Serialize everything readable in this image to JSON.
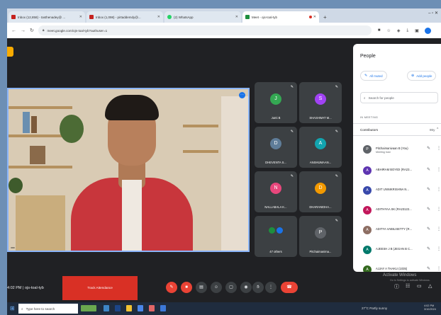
{
  "browser": {
    "tabs": [
      {
        "title": "Inbox (12,858) - tasthenadey@ ..."
      },
      {
        "title": "Inbox (1,098) - pirtaddemdy@..."
      },
      {
        "title": "(2) WhatsApp"
      },
      {
        "title": "Meet - ojs-toal-tyb"
      }
    ],
    "new_tab": "+",
    "window_controls": "–  ▫  ✕",
    "url": "meet.google.com/ojs-toal-tyb?authuser=1"
  },
  "meeting": {
    "main_video_name": "",
    "tiles": [
      {
        "initial": "J",
        "name": "Jumi B",
        "color": "#34a853"
      },
      {
        "initial": "S",
        "name": "SHASHWAT M...",
        "color": "#a142f4"
      },
      {
        "initial": "D",
        "name": "DHEVENTA S...",
        "color": "#5f7d99"
      },
      {
        "initial": "A",
        "name": "ANSHUMAAN...",
        "color": "#12a4af"
      },
      {
        "initial": "N",
        "name": "NALLABALA K...",
        "color": "#e8477c"
      },
      {
        "initial": "D",
        "name": "DHARANIDHA...",
        "color": "#f29900"
      },
      {
        "initial": "",
        "name": "47 others",
        "color": "#1e8e3e"
      },
      {
        "initial": "P",
        "name": "Pitchaimanima...",
        "color": "#5f6368"
      }
    ]
  },
  "people": {
    "title": "People",
    "mute_all": "All muted",
    "add_people": "Add people",
    "search_placeholder": "Search for people",
    "category": "IN MEETING",
    "contributors_label": "Contributors",
    "contributors_count": "86y",
    "rows": [
      {
        "initial": "P",
        "name": "Pitchaimanivaan B (You)",
        "sub": "Meeting host",
        "color": "#5f6368"
      },
      {
        "initial": "A",
        "name": "ABHIRAM BOYIDI (RA23...",
        "sub": "",
        "color": "#5e35b1"
      },
      {
        "initial": "A",
        "name": "ADIT UNNIKRISHNA N...",
        "sub": "",
        "color": "#3949ab"
      },
      {
        "initial": "A",
        "name": "ADITHYAA SK (RA23122...",
        "sub": "",
        "color": "#c2185b"
      },
      {
        "initial": "A",
        "name": "ADITYA VABILISETTY (R...",
        "sub": "",
        "color": "#8d6e63"
      },
      {
        "initial": "A",
        "name": "AJEESH J B (JEGAN B C...",
        "sub": "",
        "color": "#00796b"
      },
      {
        "initial": "A",
        "name": "AJJAY A THAKU (1035)",
        "sub": "",
        "color": "#33691e"
      }
    ]
  },
  "bottom": {
    "time_meeting": "4:02 PM  |  ojs-toal-tyb",
    "track_attendance": "Track Attendance",
    "activate_windows": "Activate Windows",
    "activate_sub": "Go to Settings to activate Windows."
  },
  "taskbar": {
    "search_placeholder": "Type here to search",
    "tray": "27°C  Partly sunny",
    "time": "4:02 PM",
    "date": "3/10/2024"
  }
}
